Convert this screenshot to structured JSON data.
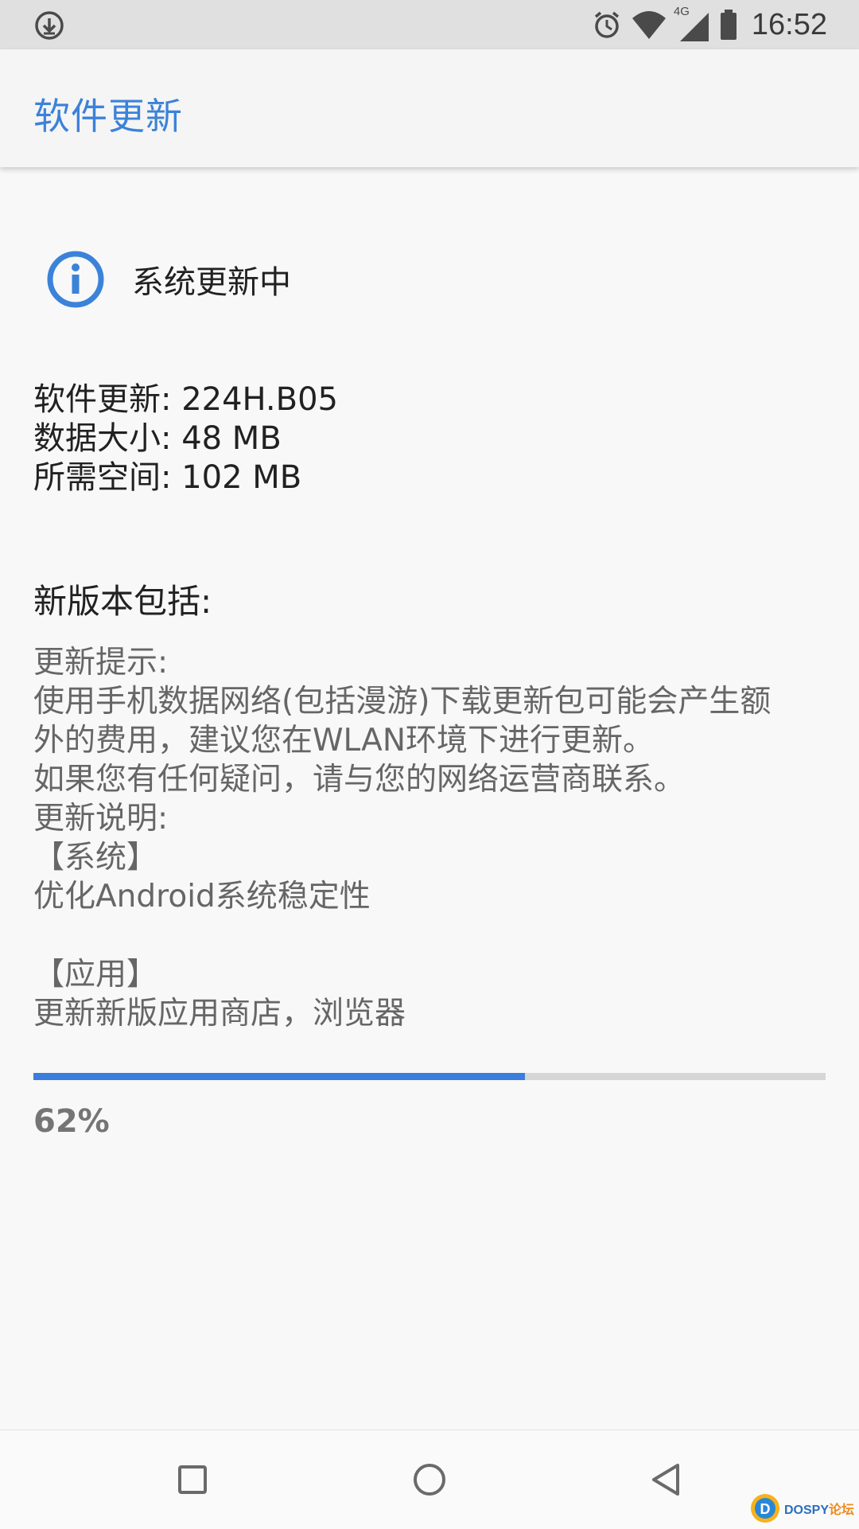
{
  "status_bar": {
    "time": "16:52",
    "network_type": "4G",
    "icons": [
      "download-icon",
      "alarm-icon",
      "wifi-icon",
      "cellular-signal-icon",
      "battery-icon"
    ]
  },
  "app_bar": {
    "title": "软件更新"
  },
  "status": {
    "icon": "info-icon",
    "text": "系统更新中"
  },
  "details": {
    "version": "软件更新: 224H.B05",
    "data_size": "数据大小: 48 MB",
    "space_required": "所需空间: 102 MB"
  },
  "release_notes": {
    "heading": "新版本包括:",
    "lines": [
      "更新提示:",
      "使用手机数据网络(包括漫游)下载更新包可能会产生额",
      "外的费用，建议您在WLAN环境下进行更新。",
      "如果您有任何疑问，请与您的网络运营商联系。",
      "更新说明:",
      "【系统】",
      "优化Android系统稳定性",
      "",
      "【应用】",
      "更新新版应用商店，浏览器"
    ]
  },
  "progress": {
    "value": 0.62,
    "label": "62%"
  },
  "nav_bar": {
    "buttons": [
      "recent-apps-icon",
      "home-icon",
      "back-icon"
    ]
  },
  "watermark": {
    "text_main": "DOSPY",
    "text_accent": "论坛"
  },
  "colors": {
    "accent": "#3b82d9",
    "progress_fill": "#3b7ddd",
    "progress_track": "#d6d6d6",
    "status_bar_bg": "#e0e0e0",
    "app_bar_bg": "#f5f5f5",
    "page_bg": "#f8f8f8"
  }
}
